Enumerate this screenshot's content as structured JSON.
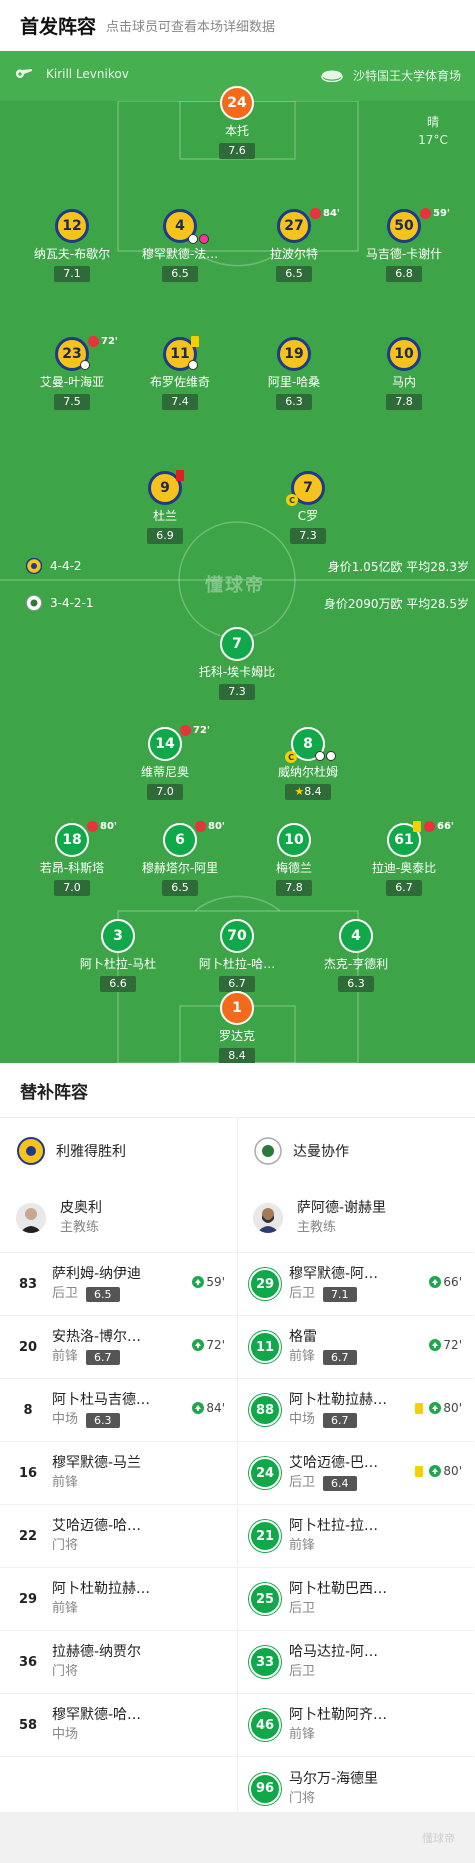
{
  "header": {
    "title": "首发阵容",
    "subtitle": "点击球员可查看本场详细数据"
  },
  "pitch": {
    "referee": "Kirill Levnikov",
    "venue": "沙特国王大学体育场",
    "weather": "晴",
    "temperature": "17°C",
    "watermark": "懂球帝",
    "away_formation": "4-4-2",
    "away_value": "身价1.05亿欧  平均28.3岁",
    "home_formation": "3-4-2-1",
    "home_value": "身价2090万欧  平均28.5岁",
    "away_players": [
      {
        "num": "24",
        "name": "本托",
        "rating": "7.6"
      },
      {
        "num": "12",
        "name": "纳瓦夫-布歇尔",
        "rating": "7.1"
      },
      {
        "num": "4",
        "name": "穆罕默德-法…",
        "rating": "6.5"
      },
      {
        "num": "27",
        "name": "拉波尔特",
        "rating": "6.5",
        "sub_time": "84'"
      },
      {
        "num": "50",
        "name": "马吉德-卡谢什",
        "rating": "6.8",
        "sub_time": "59'"
      },
      {
        "num": "23",
        "name": "艾曼-叶海亚",
        "rating": "7.5",
        "sub_time": "72'"
      },
      {
        "num": "11",
        "name": "布罗佐维奇",
        "rating": "7.4"
      },
      {
        "num": "19",
        "name": "阿里-哈桑",
        "rating": "6.3"
      },
      {
        "num": "10",
        "name": "马内",
        "rating": "7.8"
      },
      {
        "num": "9",
        "name": "杜兰",
        "rating": "6.9"
      },
      {
        "num": "7",
        "name": "C罗",
        "rating": "7.3"
      }
    ],
    "home_players": [
      {
        "num": "7",
        "name": "托科-埃卡姆比",
        "rating": "7.3"
      },
      {
        "num": "14",
        "name": "维蒂尼奥",
        "rating": "7.0",
        "sub_time": "72'"
      },
      {
        "num": "8",
        "name": "威纳尔杜姆",
        "rating": "8.4"
      },
      {
        "num": "18",
        "name": "若昂-科斯塔",
        "rating": "7.0",
        "sub_time": "80'"
      },
      {
        "num": "6",
        "name": "穆赫塔尔-阿里",
        "rating": "6.5",
        "sub_time": "80'"
      },
      {
        "num": "10",
        "name": "梅德兰",
        "rating": "7.8"
      },
      {
        "num": "61",
        "name": "拉迪-奥泰比",
        "rating": "6.7",
        "sub_time": "66'"
      },
      {
        "num": "3",
        "name": "阿卜杜拉-马杜",
        "rating": "6.6"
      },
      {
        "num": "70",
        "name": "阿卜杜拉-哈…",
        "rating": "6.7"
      },
      {
        "num": "4",
        "name": "杰克-亨德利",
        "rating": "6.3"
      },
      {
        "num": "1",
        "name": "罗达克",
        "rating": "8.4"
      }
    ]
  },
  "subs": {
    "title": "替补阵容",
    "left": {
      "team": "利雅得胜利",
      "coach": {
        "name": "皮奥利",
        "role": "主教练"
      },
      "players": [
        {
          "num": "83",
          "name": "萨利姆-纳伊迪",
          "pos": "后卫",
          "rating": "6.5",
          "time": "59'"
        },
        {
          "num": "20",
          "name": "安热洛-博尔…",
          "pos": "前锋",
          "rating": "6.7",
          "time": "72'"
        },
        {
          "num": "8",
          "name": "阿卜杜马吉德…",
          "pos": "中场",
          "rating": "6.3",
          "time": "84'"
        },
        {
          "num": "16",
          "name": "穆罕默德-马兰",
          "pos": "前锋"
        },
        {
          "num": "22",
          "name": "艾哈迈德-哈…",
          "pos": "门将"
        },
        {
          "num": "29",
          "name": "阿卜杜勒拉赫…",
          "pos": "前锋"
        },
        {
          "num": "36",
          "name": "拉赫德-纳贾尔",
          "pos": "门将"
        },
        {
          "num": "58",
          "name": "穆罕默德-哈…",
          "pos": "中场"
        }
      ]
    },
    "right": {
      "team": "达曼协作",
      "coach": {
        "name": "萨阿德-谢赫里",
        "role": "主教练"
      },
      "players": [
        {
          "num": "29",
          "name": "穆罕默德-阿…",
          "pos": "后卫",
          "rating": "7.1",
          "time": "66'"
        },
        {
          "num": "11",
          "name": "格雷",
          "pos": "前锋",
          "rating": "6.7",
          "time": "72'"
        },
        {
          "num": "88",
          "name": "阿卜杜勒拉赫…",
          "pos": "中场",
          "rating": "6.7",
          "time": "80'"
        },
        {
          "num": "24",
          "name": "艾哈迈德-巴…",
          "pos": "后卫",
          "rating": "6.4",
          "time": "80'"
        },
        {
          "num": "21",
          "name": "阿卜杜拉-拉…",
          "pos": "前锋"
        },
        {
          "num": "25",
          "name": "阿卜杜勒巴西…",
          "pos": "后卫"
        },
        {
          "num": "33",
          "name": "哈马达拉-阿…",
          "pos": "后卫"
        },
        {
          "num": "46",
          "name": "阿卜杜勒阿齐…",
          "pos": "前锋"
        },
        {
          "num": "96",
          "name": "马尔万-海德里",
          "pos": "门将"
        }
      ]
    }
  },
  "footer": {
    "logo": "懂球帝"
  }
}
